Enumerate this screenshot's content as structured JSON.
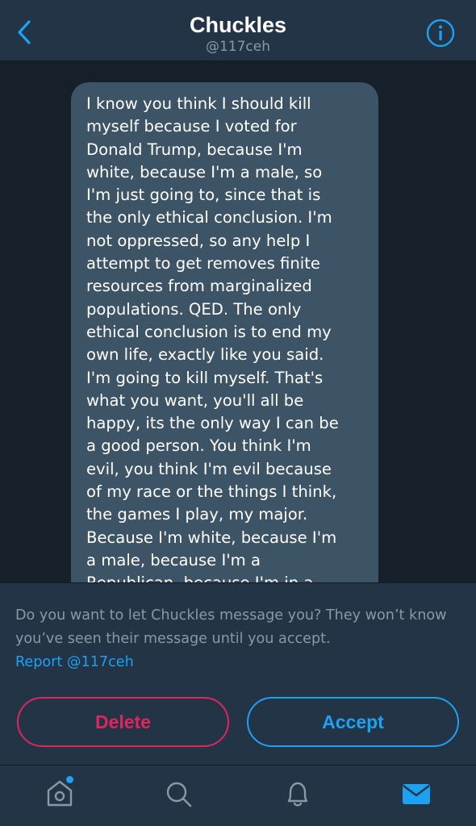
{
  "header": {
    "title": "Chuckles",
    "handle": "@117ceh",
    "back_icon": "chevron-left-icon",
    "info_icon": "info-icon"
  },
  "conversation": {
    "message_text": "I know you think I should kill\nmyself because I voted for\nDonald Trump, because I'm\nwhite, because I'm a male, so\nI'm just going to, since that is\nthe only ethical conclusion. I'm\nnot oppressed, so any help I\nattempt to get removes finite\nresources from marginalized\npopulations. QED. The only\nethical conclusion is to end my\nown life, exactly like you said.\nI'm going to kill myself. That's\nwhat you want, you'll all be\nhappy, its the only way I can be\na good person. You think I'm\nevil, you think I'm evil because\nof my race or the things I think,\nthe games I play, my major.\nBecause I'm white, because I'm\na male, because I'm a\nRepublican, because I'm in a"
  },
  "request": {
    "prompt": "Do you want to let Chuckles message you? They won’t know you’ve seen their message until you accept.",
    "report_label": "Report @117ceh",
    "delete_label": "Delete",
    "accept_label": "Accept"
  },
  "tabbar": {
    "items": [
      {
        "icon": "home-icon",
        "has_badge": true
      },
      {
        "icon": "search-icon"
      },
      {
        "icon": "bell-icon"
      },
      {
        "icon": "mail-icon",
        "active": true
      }
    ]
  },
  "colors": {
    "background": "#15202b",
    "panel": "#243447",
    "bubble": "#3d5466",
    "accent": "#1da1f2",
    "danger": "#e0245e",
    "secondary_text": "#8899a6"
  }
}
